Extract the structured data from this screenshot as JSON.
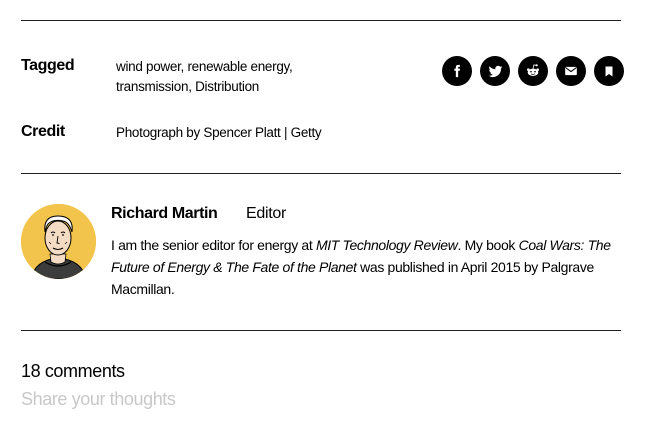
{
  "tagged": {
    "label": "Tagged",
    "tags": [
      "wind power",
      "renewable energy",
      "transmission",
      "Distribution"
    ]
  },
  "credit": {
    "label": "Credit",
    "text": "Photograph by Spencer Platt | Getty"
  },
  "share_buttons": [
    "facebook-icon",
    "twitter-icon",
    "reddit-icon",
    "email-icon",
    "bookmark-icon"
  ],
  "author": {
    "name": "Richard Martin",
    "role": "Editor",
    "bio_1": "I am the senior editor for energy at ",
    "bio_publication": "MIT Technology Review",
    "bio_2": ". My book ",
    "bio_book": "Coal Wars: The Future of Energy & The Fate of the Planet",
    "bio_3": " was published in April 2015 by Palgrave Macmillan."
  },
  "comments": {
    "count_label": "18 comments",
    "placeholder": "Share your thoughts"
  }
}
